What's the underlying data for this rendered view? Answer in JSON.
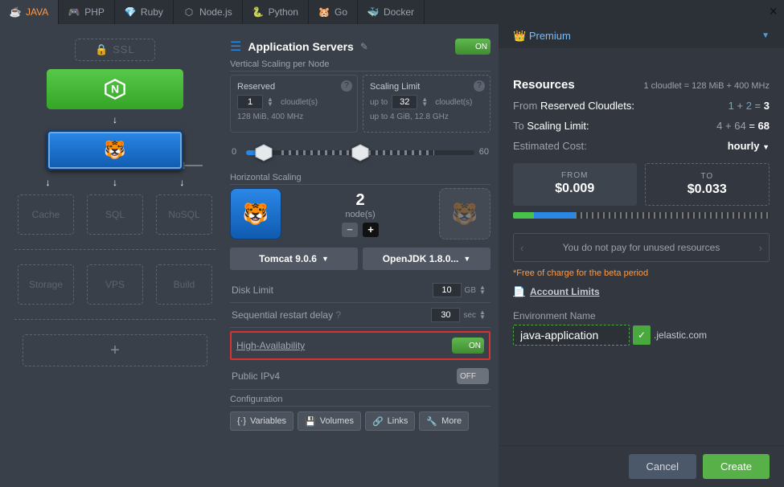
{
  "tabs": [
    "JAVA",
    "PHP",
    "Ruby",
    "Node.js",
    "Python",
    "Go",
    "Docker"
  ],
  "premium_label": "Premium",
  "topology": {
    "ssl": "SSL",
    "cache": "Cache",
    "sql": "SQL",
    "nosql": "NoSQL",
    "storage": "Storage",
    "vps": "VPS",
    "build": "Build",
    "plus": "+"
  },
  "appservers": {
    "title": "Application Servers",
    "toggle": "ON",
    "vs_label": "Vertical Scaling per Node",
    "reserved_label": "Reserved",
    "reserved_val": "1",
    "cloudlets": "cloudlet(s)",
    "reserved_meta": "128 MiB, 400 MHz",
    "limit_label": "Scaling Limit",
    "limit_prefix": "up to",
    "limit_val": "32",
    "limit_meta": "up to 4 GiB, 12.8 GHz",
    "slider_min": "0",
    "slider_max": "60",
    "hs_label": "Horizontal Scaling",
    "hs_count": "2",
    "hs_unit": "node(s)",
    "dd_server": "Tomcat 9.0.6",
    "dd_jdk": "OpenJDK 1.8.0...",
    "disk_label": "Disk Limit",
    "disk_val": "10",
    "disk_unit": "GB",
    "seq_label": "Sequential restart delay",
    "seq_val": "30",
    "seq_unit": "sec",
    "ha_label": "High-Availability",
    "ha_toggle": "ON",
    "ipv4_label": "Public IPv4",
    "ipv4_toggle": "OFF",
    "cfg_label": "Configuration",
    "cfg_btns": [
      "Variables",
      "Volumes",
      "Links",
      "More"
    ]
  },
  "resources": {
    "title": "Resources",
    "sub": "1 cloudlet = 128 MiB + 400 MHz",
    "row1_l": "From Reserved Cloudlets:",
    "row1_a": "1",
    "row1_b": "2",
    "row1_eq": "= ",
    "row1_s": "3",
    "row2_l": "To Scaling Limit:",
    "row2_a": "4",
    "row2_b": "64",
    "row2_s": "68",
    "row3_l": "Estimated Cost:",
    "row3_v": "hourly",
    "from_l": "FROM",
    "from_v": "$0.009",
    "to_l": "TO",
    "to_v": "$0.033",
    "banner": "You do not pay for unused resources",
    "beta": "*Free of charge for the beta period",
    "acct": "Account Limits",
    "env_l": "Environment Name",
    "env_val": "java-application",
    "env_suffix": ".jelastic.com"
  },
  "buttons": {
    "cancel": "Cancel",
    "create": "Create"
  }
}
